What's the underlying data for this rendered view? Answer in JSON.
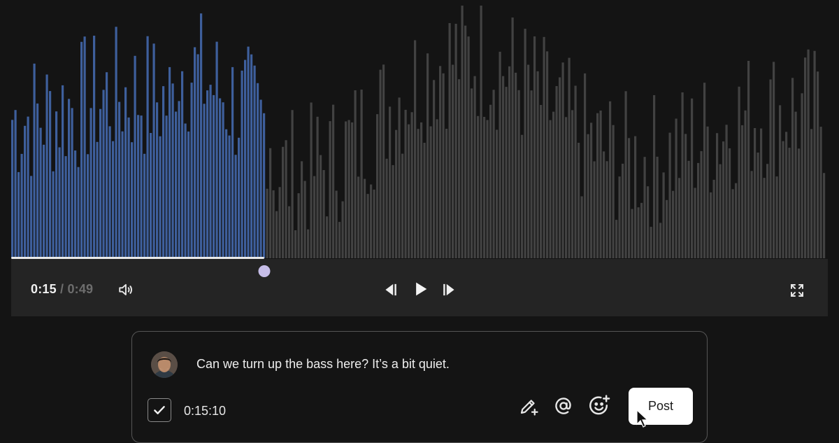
{
  "player": {
    "current_time": "0:15",
    "separator": "/",
    "total_time": "0:49",
    "progress_fraction": 0.3096,
    "colors": {
      "played_wave": "#3e5f9c",
      "unplayed_wave": "#424242",
      "scrubber": "#c6bde8",
      "progress_line": "#e9e9e9"
    },
    "icons": {
      "volume": "volume-icon",
      "previous": "skip-back-icon",
      "play": "play-icon",
      "next": "skip-forward-icon",
      "fullscreen": "fullscreen-icon"
    }
  },
  "comment": {
    "text": "Can we turn up the bass here? It’s a bit quiet.",
    "timestamp": "0:15:10",
    "checked": true,
    "post_label": "Post",
    "icons": {
      "annotate": "pencil-plus-icon",
      "mention": "at-sign-icon",
      "emoji": "emoji-add-icon",
      "avatar": "user-avatar"
    }
  }
}
